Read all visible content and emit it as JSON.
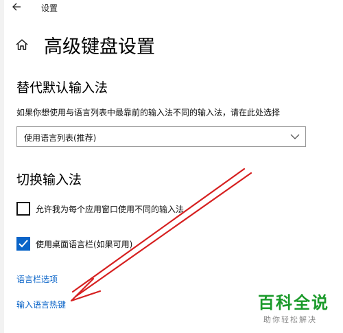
{
  "window": {
    "title": "设置",
    "back_icon": "back-arrow-icon"
  },
  "header": {
    "home_icon": "home-icon",
    "title": "高级键盘设置"
  },
  "override_section": {
    "title": "替代默认输入法",
    "description": "如果你想使用与语言列表中最靠前的输入法不同的输入法，请在此处选择",
    "dropdown_value": "使用语言列表(推荐)"
  },
  "switch_section": {
    "title": "切换输入法",
    "options": [
      {
        "label": "允许我为每个应用窗口使用不同的输入法",
        "checked": false
      },
      {
        "label": "使用桌面语言栏(如果可用)",
        "checked": true
      }
    ]
  },
  "links": {
    "language_bar_options": "语言栏选项",
    "input_language_hotkeys": "输入语言热键"
  },
  "watermark": {
    "brand": "百科全说",
    "slogan": "助你轻松解决"
  },
  "colors": {
    "accent": "#0a64c8",
    "annotation_arrow": "#d62020",
    "watermark_green": "#1a9a2a"
  }
}
